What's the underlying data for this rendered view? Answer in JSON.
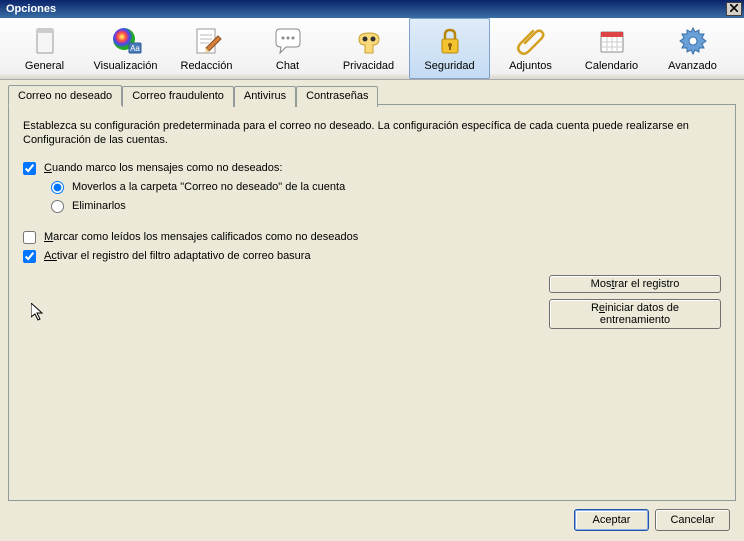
{
  "window": {
    "title": "Opciones"
  },
  "toolbar": {
    "items": [
      {
        "label": "General"
      },
      {
        "label": "Visualización"
      },
      {
        "label": "Redacción"
      },
      {
        "label": "Chat"
      },
      {
        "label": "Privacidad"
      },
      {
        "label": "Seguridad"
      },
      {
        "label": "Adjuntos"
      },
      {
        "label": "Calendario"
      },
      {
        "label": "Avanzado"
      }
    ],
    "selected": "Seguridad"
  },
  "tabs": {
    "items": [
      {
        "label": "Correo no deseado"
      },
      {
        "label": "Correo fraudulento"
      },
      {
        "label": "Antivirus"
      },
      {
        "label": "Contraseñas"
      }
    ],
    "active": "Correo no deseado"
  },
  "panel": {
    "description": "Establezca su configuración predeterminada para el correo no deseado. La configuración específica de cada cuenta puede realizarse en Configuración de las cuentas.",
    "chk_when_mark": {
      "checked": true,
      "prefix": "C",
      "rest": "uando marco los mensajes como no deseados:"
    },
    "radio_move": {
      "selected": true,
      "text": "Moverlos a la carpeta \"Correo no deseado\" de la cuenta"
    },
    "radio_delete": {
      "selected": false,
      "text": "Eliminarlos"
    },
    "chk_mark_read": {
      "checked": false,
      "prefix": "M",
      "rest": "arcar como leídos los mensajes calificados como no deseados"
    },
    "chk_enable_log": {
      "checked": true,
      "prefix": "Ac",
      "rest": "tivar el registro del filtro adaptativo de correo basura"
    },
    "btn_show_log": {
      "prefix": "Mos",
      "u": "t",
      "rest": "rar el registro"
    },
    "btn_reset": {
      "prefix": "R",
      "u": "e",
      "rest": "iniciar datos de entrenamiento"
    }
  },
  "footer": {
    "ok": "Aceptar",
    "cancel": "Cancelar"
  }
}
